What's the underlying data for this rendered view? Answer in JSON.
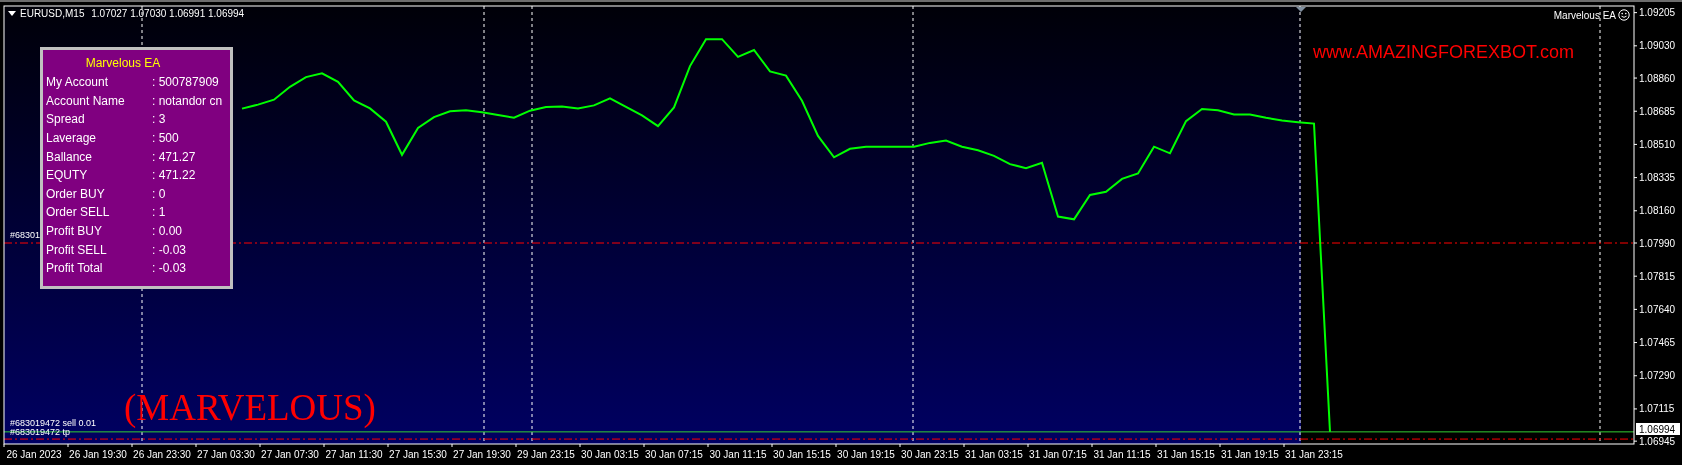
{
  "chart_header": {
    "symbol": "EURUSD,M15",
    "quotes": "1.07027 1.07030 1.06991 1.06994"
  },
  "ea_label": "Marvelous EA",
  "website": "www.AMAZINGFOREXBOT.com",
  "banner": "(MARVELOUS)",
  "info_panel": {
    "title": "Marvelous EA",
    "rows": [
      {
        "label": "My Account",
        "value": ": 500787909"
      },
      {
        "label": "Account Name",
        "value": ": notandor cn"
      },
      {
        "label": "Spread",
        "value": ": 3"
      },
      {
        "label": "Laverage",
        "value": ": 500"
      },
      {
        "label": "Ballance",
        "value": ": 471.27"
      },
      {
        "label": "EQUTY",
        "value": ": 471.22"
      },
      {
        "label": "Order BUY",
        "value": ": 0"
      },
      {
        "label": "Order SELL",
        "value": ": 1"
      },
      {
        "label": "Profit BUY",
        "value": ": 0.00"
      },
      {
        "label": "Profit SELL",
        "value": ": -0.03"
      },
      {
        "label": "Profit Total",
        "value": ": -0.03"
      }
    ]
  },
  "order_labels": [
    {
      "text": "#68301"
    },
    {
      "text": "#683019472 sell 0.01"
    },
    {
      "text": "#683019472 tp"
    }
  ],
  "current_price": "1.06994",
  "chart_data": {
    "type": "line",
    "categories": [
      "26 Jan 2023",
      null,
      null,
      null,
      "26 Jan 19:30",
      null,
      null,
      null,
      "26 Jan 23:30",
      null,
      null,
      null,
      "27 Jan 03:30",
      null,
      null,
      null,
      "27 Jan 07:30",
      null,
      null,
      null,
      "27 Jan 11:30",
      null,
      null,
      null,
      "27 Jan 15:30",
      null,
      null,
      null,
      "27 Jan 19:30",
      null,
      null,
      null,
      "29 Jan 23:15",
      null,
      null,
      null,
      "30 Jan 03:15",
      null,
      null,
      null,
      "30 Jan 07:15",
      null,
      null,
      null,
      "30 Jan 11:15",
      null,
      null,
      null,
      "30 Jan 15:15",
      null,
      null,
      null,
      "30 Jan 19:15",
      null,
      null,
      null,
      "30 Jan 23:15",
      null,
      null,
      null,
      "31 Jan 03:15",
      null,
      null,
      null,
      "31 Jan 07:15",
      null,
      null,
      null,
      "31 Jan 11:15",
      null,
      null,
      null,
      "31 Jan 15:15",
      null,
      null,
      null,
      "31 Jan 19:15",
      null,
      null,
      null,
      "31 Jan 23:15",
      null
    ],
    "series": [
      {
        "color": "#00ff00",
        "values": [
          null,
          null,
          null,
          null,
          null,
          null,
          null,
          null,
          null,
          null,
          null,
          null,
          null,
          1.08699,
          1.0872,
          1.08746,
          1.08814,
          1.08865,
          1.08885,
          1.0884,
          1.08742,
          1.087,
          1.0863,
          1.08455,
          1.08597,
          1.08654,
          1.08685,
          1.0869,
          1.0868,
          1.08665,
          1.08651,
          1.08688,
          1.08707,
          1.0871,
          1.087,
          1.08716,
          1.08753,
          1.08708,
          1.08663,
          1.08606,
          1.08705,
          1.08923,
          1.09065,
          1.09065,
          1.08972,
          1.09008,
          1.08895,
          1.08873,
          1.0874,
          1.08555,
          1.08442,
          1.08487,
          1.08498,
          1.08498,
          1.08498,
          1.08498,
          1.08518,
          1.0853,
          1.08498,
          1.08479,
          1.0845,
          1.08406,
          1.08385,
          1.08413,
          1.0813,
          1.08115,
          1.08243,
          1.0826,
          1.08328,
          1.08357,
          1.08498,
          1.08463,
          1.08633,
          1.08697,
          1.0869,
          1.08668,
          1.08668,
          1.08651,
          1.08636,
          1.08627,
          1.0862,
          1.06994
        ]
      }
    ],
    "ylim": [
      1.0693,
      1.0924
    ],
    "yticks": [
      {
        "value": 1.09205,
        "label": "1.09205"
      },
      {
        "value": 1.0903,
        "label": "1.09030"
      },
      {
        "value": 1.0886,
        "label": "1.08860"
      },
      {
        "value": 1.08685,
        "label": "1.08685"
      },
      {
        "value": 1.0851,
        "label": "1.08510"
      },
      {
        "value": 1.08335,
        "label": "1.08335"
      },
      {
        "value": 1.0816,
        "label": "1.08160"
      },
      {
        "value": 1.0799,
        "label": "1.07990"
      },
      {
        "value": 1.07815,
        "label": "1.07815"
      },
      {
        "value": 1.0764,
        "label": "1.07640"
      },
      {
        "value": 1.07465,
        "label": "1.07465"
      },
      {
        "value": 1.0729,
        "label": "1.07290"
      },
      {
        "value": 1.07115,
        "label": "1.07115"
      },
      {
        "value": 1.06945,
        "label": "1.06945"
      }
    ],
    "grid": true,
    "ref_lines": [
      {
        "axis": "y",
        "value": 1.0799,
        "color": "#ff0000"
      },
      {
        "axis": "y",
        "value": 1.06994,
        "color": "#32cd32"
      },
      {
        "axis": "y",
        "value": 1.06956,
        "color": "#ff0000"
      }
    ]
  }
}
